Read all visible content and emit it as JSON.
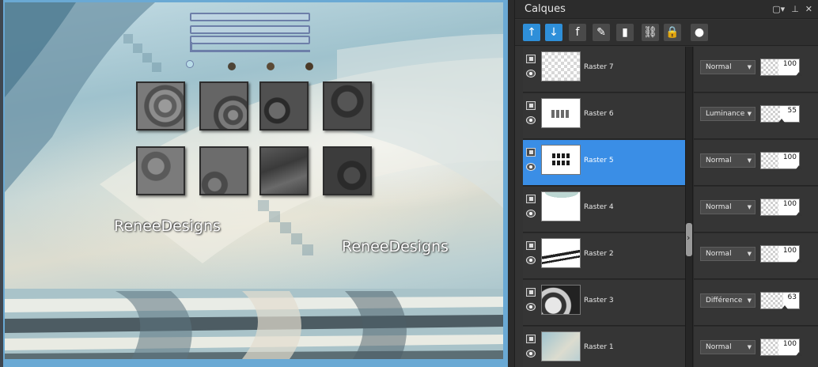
{
  "canvas": {
    "watermarks": [
      "ReneeDesigns",
      "ReneeDesigns"
    ]
  },
  "panel": {
    "title": "Calques",
    "title_icons": [
      "restore-icon",
      "pin-icon",
      "close-icon"
    ],
    "toolbar_icons": [
      {
        "name": "new-layer-icon",
        "glyph": "↑",
        "bg": "#2e8fd9"
      },
      {
        "name": "merge-down-icon",
        "glyph": "↓",
        "bg": "#2e8fd9"
      },
      {
        "name": "effects-fx-icon",
        "glyph": "f",
        "bg": "#4a4a4a"
      },
      {
        "name": "edit-layer-icon",
        "glyph": "✎",
        "bg": "#4a4a4a"
      },
      {
        "name": "delete-layer-icon",
        "glyph": "▮",
        "bg": "#4a4a4a"
      },
      {
        "name": "link-icon",
        "glyph": "⛓",
        "bg": "#4a4a4a"
      },
      {
        "name": "lock-icon",
        "glyph": "🔒",
        "bg": "#4a4a4a"
      },
      {
        "name": "brush-icon",
        "glyph": "●",
        "bg": "#4a4a4a"
      }
    ],
    "accent": "#3a8ee6",
    "layers": [
      {
        "name": "Raster 7",
        "blend": "Normal",
        "opacity": "100",
        "opacity_fraction": 1.0,
        "selected": false,
        "thumb": "empty"
      },
      {
        "name": "Raster 6",
        "blend": "Luminance",
        "opacity": "55",
        "opacity_fraction": 0.55,
        "selected": false,
        "thumb": "tiles"
      },
      {
        "name": "Raster 5",
        "blend": "Normal",
        "opacity": "100",
        "opacity_fraction": 1.0,
        "selected": true,
        "thumb": "dark-tiles"
      },
      {
        "name": "Raster 4",
        "blend": "Normal",
        "opacity": "100",
        "opacity_fraction": 1.0,
        "selected": false,
        "thumb": "wave"
      },
      {
        "name": "Raster 2",
        "blend": "Normal",
        "opacity": "100",
        "opacity_fraction": 1.0,
        "selected": false,
        "thumb": "stripes"
      },
      {
        "name": "Raster 3",
        "blend": "Différence",
        "opacity": "63",
        "opacity_fraction": 0.63,
        "selected": false,
        "thumb": "swirl"
      },
      {
        "name": "Raster 1",
        "blend": "Normal",
        "opacity": "100",
        "opacity_fraction": 1.0,
        "selected": false,
        "thumb": "gradient"
      }
    ]
  }
}
